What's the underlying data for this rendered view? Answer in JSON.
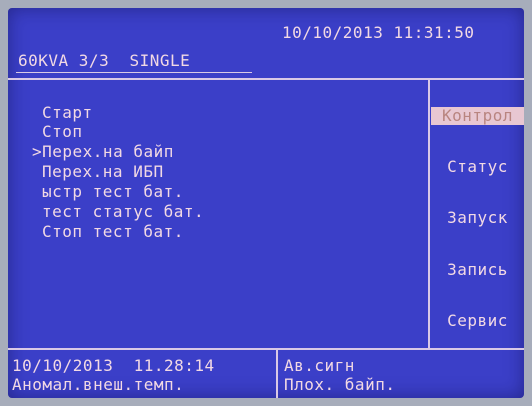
{
  "header": {
    "device_mode": "60KVA 3/3  SINGLE",
    "datetime": "10/10/2013 11:31:50"
  },
  "menu": {
    "items": [
      {
        "label": "Старт",
        "selected": false
      },
      {
        "label": "Стоп",
        "selected": false
      },
      {
        "label": ">Перех.на байп",
        "selected": true
      },
      {
        "label": "Перех.на ИБП",
        "selected": false
      },
      {
        "label": "ыстр тест бат.",
        "selected": false
      },
      {
        "label": "тест статус бат.",
        "selected": false
      },
      {
        "label": "Стоп тест бат.",
        "selected": false
      }
    ]
  },
  "softkeys": [
    {
      "label": "Контрол",
      "active": true
    },
    {
      "label": "Статус",
      "active": false
    },
    {
      "label": "Запуск",
      "active": false
    },
    {
      "label": "Запись",
      "active": false
    },
    {
      "label": "Сервис",
      "active": false
    }
  ],
  "footer": {
    "event_datetime": "10/10/2013  11.28:14",
    "event_text": "Аномал.внеш.темп.",
    "alarm_title": "Ав.сигн",
    "alarm_text": "Плох. байп."
  },
  "colors": {
    "screen": "#3b3fc8",
    "text": "#f2d9e4",
    "highlight_bg": "#e8c7d2"
  }
}
